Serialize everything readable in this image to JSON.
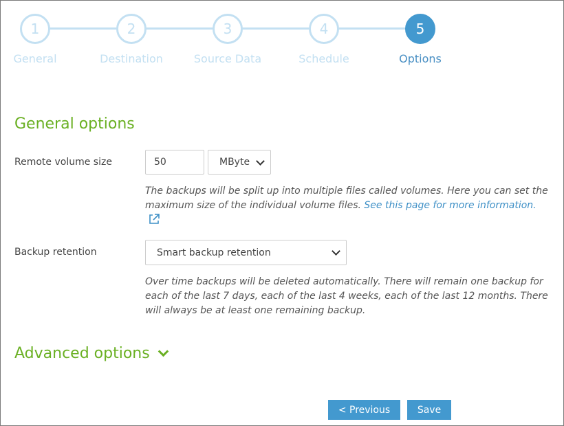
{
  "stepper": {
    "steps": [
      {
        "number": "1",
        "label": "General"
      },
      {
        "number": "2",
        "label": "Destination"
      },
      {
        "number": "3",
        "label": "Source Data"
      },
      {
        "number": "4",
        "label": "Schedule"
      },
      {
        "number": "5",
        "label": "Options"
      }
    ],
    "active_step": 5
  },
  "general_options": {
    "title": "General options",
    "remote_volume": {
      "label": "Remote volume size",
      "value": "50",
      "unit": "MByte",
      "help_text": "The backups will be split up into multiple files called volumes. Here you can set the maximum size of the individual volume files.",
      "help_link": "See this page for more information."
    },
    "backup_retention": {
      "label": "Backup retention",
      "value": "Smart backup retention",
      "help_text": "Over time backups will be deleted automatically. There will remain one backup for each of the last 7 days, each of the last 4 weeks, each of the last 12 months. There will always be at least one remaining backup."
    }
  },
  "advanced_options": {
    "title": "Advanced options"
  },
  "buttons": {
    "previous": "< Previous",
    "save": "Save"
  },
  "colors": {
    "accent_blue": "#4399cf",
    "step_inactive": "#c3e0f2",
    "section_green": "#6ab023"
  }
}
